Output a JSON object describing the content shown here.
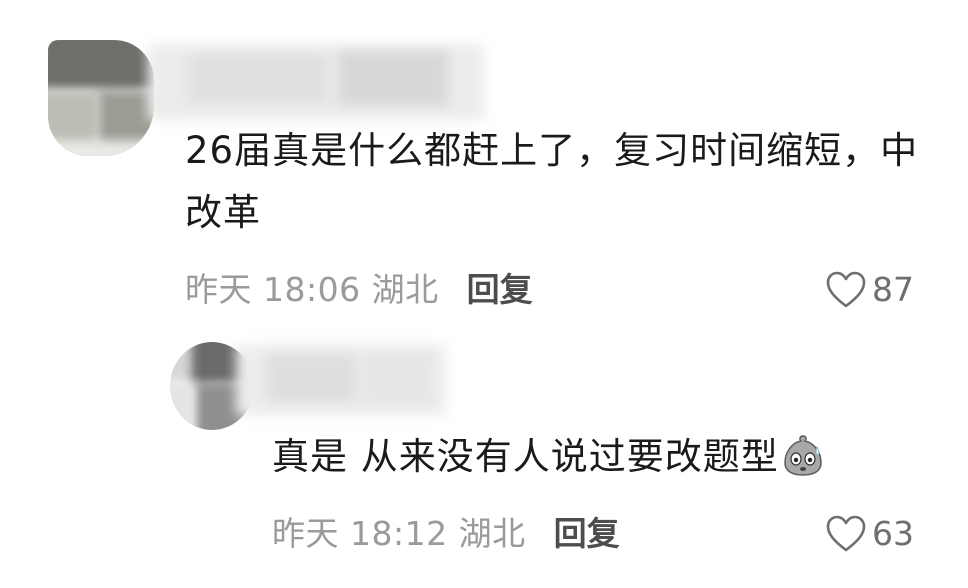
{
  "comments": [
    {
      "text_line1": "26届真是什么都赶上了，复习时间缩短，中",
      "text_line2": "改革",
      "time": "昨天 18:06 湖北",
      "reply_label": "回复",
      "likes": "87",
      "avatar_colors": [
        "#6e6e6a",
        "#bdbdb6",
        "#9c9c95",
        "#d9d9d4"
      ],
      "name_colors": [
        "#e4e4e4",
        "#d2d2d2",
        "#ececec"
      ]
    },
    {
      "text": "真是 从来没有人说过要改题型",
      "emoji": "sweating-ghost-emoji",
      "time": "昨天 18:12 湖北",
      "reply_label": "回复",
      "likes": "63",
      "avatar_colors": [
        "#6a6a6a",
        "#bdbdbd",
        "#8f8f8f",
        "#d0d0d0"
      ],
      "name_colors": [
        "#e3e3e3",
        "#d6d6d6",
        "#ededed"
      ]
    }
  ],
  "icons": {
    "like": "heart-outline-icon"
  },
  "colors": {
    "text": "#1a1a1a",
    "meta": "#9a9a9a",
    "reply": "#4d4d4d",
    "likes": "#6f6f6f"
  }
}
